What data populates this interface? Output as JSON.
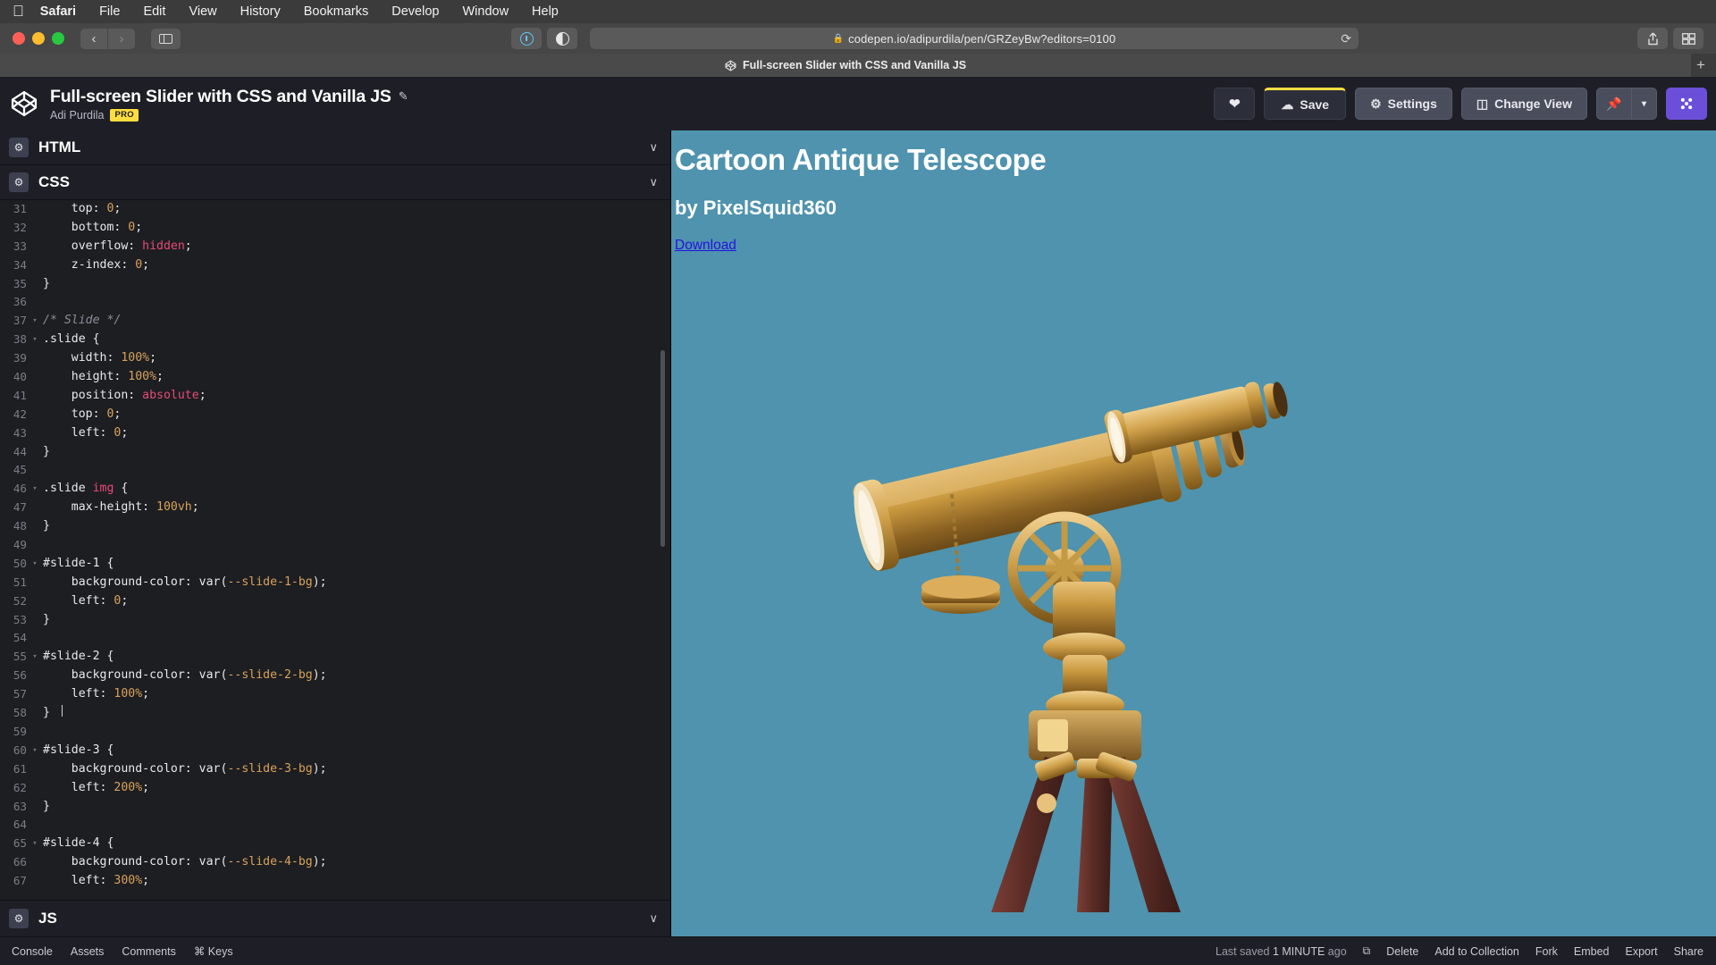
{
  "os_menubar": {
    "apple_icon": "apple-icon",
    "items": [
      {
        "label": "Safari",
        "bold": true
      },
      {
        "label": "File",
        "bold": false
      },
      {
        "label": "Edit",
        "bold": false
      },
      {
        "label": "View",
        "bold": false
      },
      {
        "label": "History",
        "bold": false
      },
      {
        "label": "Bookmarks",
        "bold": false
      },
      {
        "label": "Develop",
        "bold": false
      },
      {
        "label": "Window",
        "bold": false
      },
      {
        "label": "Help",
        "bold": false
      }
    ]
  },
  "browser": {
    "back_glyph": "‹",
    "forward_glyph": "›",
    "sidebar_icon": "sidebar-icon",
    "reader_icon": "reader-view-icon",
    "contrast_icon": "contrast-icon",
    "url": "codepen.io/adipurdila/pen/GRZeyBw?editors=0100",
    "lock_glyph": "🔒",
    "reload_glyph": "⟳",
    "share_glyph": "⬆",
    "tabs_glyph": "❐",
    "tab": {
      "title": "Full-screen Slider with CSS and Vanilla JS",
      "favicon": "codepen-icon"
    },
    "new_tab_glyph": "+"
  },
  "pen_header": {
    "logo_icon": "codepen-logo-icon",
    "title": "Full-screen Slider with CSS and Vanilla JS",
    "edit_glyph": "✎",
    "author": "Adi Purdila",
    "pro_badge": "PRO",
    "actions": {
      "love_label": "",
      "love_icon": "heart-icon",
      "save_label": "Save",
      "save_icon": "cloud-icon",
      "settings_label": "Settings",
      "settings_icon": "gear-icon",
      "change_view_label": "Change View",
      "change_view_icon": "layout-icon",
      "pin_icon": "pin-icon",
      "caret_glyph": "▾",
      "menu_icon": "grid-menu-icon"
    },
    "accent_yellow": "#ffdd40",
    "accent_purple": "#6c4fd8"
  },
  "editor": {
    "panes": [
      {
        "label": "HTML",
        "gear_icon": "gear-icon",
        "caret_glyph": "∨"
      },
      {
        "label": "CSS",
        "gear_icon": "gear-icon",
        "caret_glyph": "∨"
      },
      {
        "label": "JS",
        "gear_icon": "gear-icon",
        "caret_glyph": "∨"
      }
    ],
    "active_pane": "CSS",
    "first_line_number": 31,
    "code_lines": [
      {
        "n": 31,
        "fold": "",
        "tokens": [
          {
            "t": "    top: ",
            "c": "prop"
          },
          {
            "t": "0",
            "c": "val"
          },
          {
            "t": ";",
            "c": "punc"
          }
        ]
      },
      {
        "n": 32,
        "fold": "",
        "tokens": [
          {
            "t": "    bottom: ",
            "c": "prop"
          },
          {
            "t": "0",
            "c": "val"
          },
          {
            "t": ";",
            "c": "punc"
          }
        ]
      },
      {
        "n": 33,
        "fold": "",
        "tokens": [
          {
            "t": "    overflow: ",
            "c": "prop"
          },
          {
            "t": "hidden",
            "c": "kw"
          },
          {
            "t": ";",
            "c": "punc"
          }
        ]
      },
      {
        "n": 34,
        "fold": "",
        "tokens": [
          {
            "t": "    z-index: ",
            "c": "prop"
          },
          {
            "t": "0",
            "c": "val"
          },
          {
            "t": ";",
            "c": "punc"
          }
        ]
      },
      {
        "n": 35,
        "fold": "",
        "tokens": [
          {
            "t": "}",
            "c": "punc"
          }
        ]
      },
      {
        "n": 36,
        "fold": "",
        "tokens": []
      },
      {
        "n": 37,
        "fold": "▾",
        "tokens": [
          {
            "t": "/* Slide */",
            "c": "com"
          }
        ]
      },
      {
        "n": 38,
        "fold": "▾",
        "tokens": [
          {
            "t": ".slide {",
            "c": "sel"
          }
        ]
      },
      {
        "n": 39,
        "fold": "",
        "tokens": [
          {
            "t": "    width: ",
            "c": "prop"
          },
          {
            "t": "100%",
            "c": "val"
          },
          {
            "t": ";",
            "c": "punc"
          }
        ]
      },
      {
        "n": 40,
        "fold": "",
        "tokens": [
          {
            "t": "    height: ",
            "c": "prop"
          },
          {
            "t": "100%",
            "c": "val"
          },
          {
            "t": ";",
            "c": "punc"
          }
        ]
      },
      {
        "n": 41,
        "fold": "",
        "tokens": [
          {
            "t": "    position: ",
            "c": "prop"
          },
          {
            "t": "absolute",
            "c": "kw"
          },
          {
            "t": ";",
            "c": "punc"
          }
        ]
      },
      {
        "n": 42,
        "fold": "",
        "tokens": [
          {
            "t": "    top: ",
            "c": "prop"
          },
          {
            "t": "0",
            "c": "val"
          },
          {
            "t": ";",
            "c": "punc"
          }
        ]
      },
      {
        "n": 43,
        "fold": "",
        "tokens": [
          {
            "t": "    left: ",
            "c": "prop"
          },
          {
            "t": "0",
            "c": "val"
          },
          {
            "t": ";",
            "c": "punc"
          }
        ]
      },
      {
        "n": 44,
        "fold": "",
        "tokens": [
          {
            "t": "}",
            "c": "punc"
          }
        ]
      },
      {
        "n": 45,
        "fold": "",
        "tokens": []
      },
      {
        "n": 46,
        "fold": "▾",
        "tokens": [
          {
            "t": ".slide ",
            "c": "sel"
          },
          {
            "t": "img",
            "c": "tag"
          },
          {
            "t": " {",
            "c": "sel"
          }
        ]
      },
      {
        "n": 47,
        "fold": "",
        "tokens": [
          {
            "t": "    max-height: ",
            "c": "prop"
          },
          {
            "t": "100vh",
            "c": "val"
          },
          {
            "t": ";",
            "c": "punc"
          }
        ]
      },
      {
        "n": 48,
        "fold": "",
        "tokens": [
          {
            "t": "}",
            "c": "punc"
          }
        ]
      },
      {
        "n": 49,
        "fold": "",
        "tokens": []
      },
      {
        "n": 50,
        "fold": "▾",
        "tokens": [
          {
            "t": "#slide-1 {",
            "c": "sel"
          }
        ]
      },
      {
        "n": 51,
        "fold": "",
        "tokens": [
          {
            "t": "    background-color: ",
            "c": "prop"
          },
          {
            "t": "var(",
            "c": "punc"
          },
          {
            "t": "--slide-1-bg",
            "c": "var"
          },
          {
            "t": ");",
            "c": "punc"
          }
        ]
      },
      {
        "n": 52,
        "fold": "",
        "tokens": [
          {
            "t": "    left: ",
            "c": "prop"
          },
          {
            "t": "0",
            "c": "val"
          },
          {
            "t": ";",
            "c": "punc"
          }
        ]
      },
      {
        "n": 53,
        "fold": "",
        "tokens": [
          {
            "t": "}",
            "c": "punc"
          }
        ]
      },
      {
        "n": 54,
        "fold": "",
        "tokens": []
      },
      {
        "n": 55,
        "fold": "▾",
        "tokens": [
          {
            "t": "#slide-2 {",
            "c": "sel"
          }
        ]
      },
      {
        "n": 56,
        "fold": "",
        "tokens": [
          {
            "t": "    background-color: ",
            "c": "prop"
          },
          {
            "t": "var(",
            "c": "punc"
          },
          {
            "t": "--slide-2-bg",
            "c": "var"
          },
          {
            "t": ");",
            "c": "punc"
          }
        ]
      },
      {
        "n": 57,
        "fold": "",
        "tokens": [
          {
            "t": "    left: ",
            "c": "prop"
          },
          {
            "t": "100%",
            "c": "val"
          },
          {
            "t": ";",
            "c": "punc"
          }
        ]
      },
      {
        "n": 58,
        "fold": "",
        "tokens": [
          {
            "t": "}",
            "c": "punc"
          }
        ]
      },
      {
        "n": 59,
        "fold": "",
        "tokens": []
      },
      {
        "n": 60,
        "fold": "▾",
        "tokens": [
          {
            "t": "#slide-3 {",
            "c": "sel"
          }
        ]
      },
      {
        "n": 61,
        "fold": "",
        "tokens": [
          {
            "t": "    background-color: ",
            "c": "prop"
          },
          {
            "t": "var(",
            "c": "punc"
          },
          {
            "t": "--slide-3-bg",
            "c": "var"
          },
          {
            "t": ");",
            "c": "punc"
          }
        ]
      },
      {
        "n": 62,
        "fold": "",
        "tokens": [
          {
            "t": "    left: ",
            "c": "prop"
          },
          {
            "t": "200%",
            "c": "val"
          },
          {
            "t": ";",
            "c": "punc"
          }
        ]
      },
      {
        "n": 63,
        "fold": "",
        "tokens": [
          {
            "t": "}",
            "c": "punc"
          }
        ]
      },
      {
        "n": 64,
        "fold": "",
        "tokens": []
      },
      {
        "n": 65,
        "fold": "▾",
        "tokens": [
          {
            "t": "#slide-4 {",
            "c": "sel"
          }
        ]
      },
      {
        "n": 66,
        "fold": "",
        "tokens": [
          {
            "t": "    background-color: ",
            "c": "prop"
          },
          {
            "t": "var(",
            "c": "punc"
          },
          {
            "t": "--slide-4-bg",
            "c": "var"
          },
          {
            "t": ");",
            "c": "punc"
          }
        ]
      },
      {
        "n": 67,
        "fold": "",
        "tokens": [
          {
            "t": "    left: ",
            "c": "prop"
          },
          {
            "t": "300%",
            "c": "val"
          },
          {
            "t": ";",
            "c": "punc"
          }
        ]
      }
    ]
  },
  "preview": {
    "title": "Cartoon Antique Telescope",
    "subtitle": "by PixelSquid360",
    "link": "Download",
    "background_color": "#4f93ae",
    "link_color": "#2214e0",
    "illustration": "telescope-illustration"
  },
  "bottom_bar": {
    "left_items": [
      {
        "label": "Console"
      },
      {
        "label": "Assets"
      },
      {
        "label": "Comments"
      },
      {
        "label": "⌘ Keys"
      }
    ],
    "saved_prefix": "Last saved",
    "saved_time": "1 MINUTE",
    "saved_suffix": "ago",
    "external_glyph": "⧉",
    "right_items": [
      {
        "label": "Delete"
      },
      {
        "label": "Add to Collection"
      },
      {
        "label": "Fork"
      },
      {
        "label": "Embed"
      },
      {
        "label": "Export"
      },
      {
        "label": "Share"
      }
    ]
  }
}
